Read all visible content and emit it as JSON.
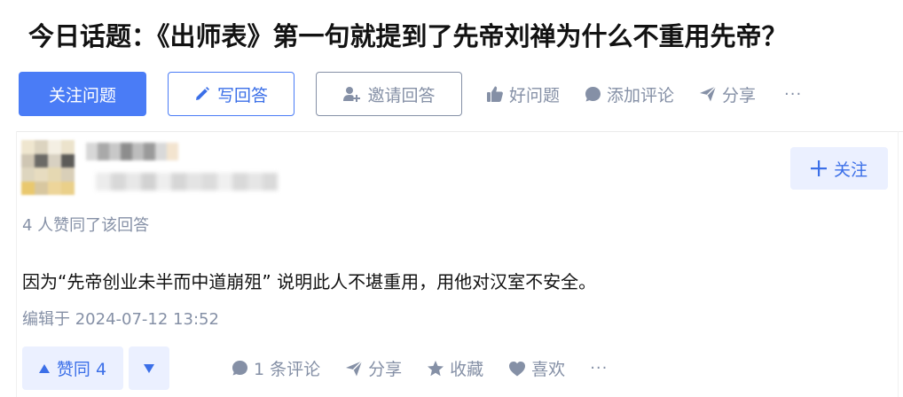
{
  "question": {
    "title": "今日话题：《出师表》第一句就提到了先帝刘禅为什么不重用先帝？"
  },
  "toolbar": {
    "follow_question": "关注问题",
    "write_answer": "写回答",
    "invite_answer": "邀请回答",
    "good_question": "好问题",
    "add_comment": "添加评论",
    "share": "分享",
    "more": "···"
  },
  "answer": {
    "follow_label": "关注",
    "votes_text": "4 人赞同了该回答",
    "content": "因为“先帝创业未半而中道崩殂” 说明此人不堪重用，用他对汉室不安全。",
    "edited": "编辑于 2024-07-12 13:52",
    "vote_up_label": "赞同 4",
    "comments": "1 条评论",
    "share": "分享",
    "collect": "收藏",
    "like": "喜欢",
    "more": "···"
  },
  "colors": {
    "accent": "#4a7cf6",
    "accent_light": "#ebf0ff",
    "muted": "#8590a6"
  }
}
